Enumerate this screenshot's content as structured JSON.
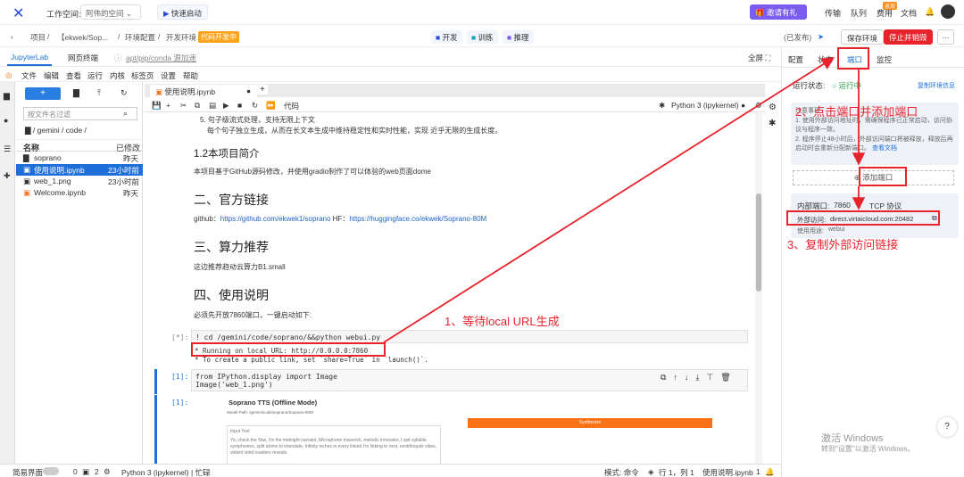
{
  "topbar": {
    "workspace_label": "工作空间:",
    "workspace_value": "阿伟的空间",
    "quick_start": "快速启动",
    "invite": "邀请有礼",
    "links": [
      "传输",
      "队列",
      "费用",
      "文档"
    ],
    "fee_badge": "返现"
  },
  "bar2": {
    "crumbs": [
      "项目",
      "【ekwek/Sop...",
      "环境配置",
      "开发环境"
    ],
    "status_tag": "代码开发中",
    "modes": [
      "开发",
      "训练",
      "推理"
    ],
    "published": "(已发布)",
    "save_env": "保存环境",
    "stop_destroy": "停止并销毁",
    "more": "···"
  },
  "bar3": {
    "tabs": [
      "JupyterLab",
      "网页终端"
    ],
    "path_hint": "apt/pip/conda 源加速",
    "fullscreen": "全屏"
  },
  "menu": [
    "文件",
    "编辑",
    "查看",
    "运行",
    "内核",
    "标签页",
    "设置",
    "帮助"
  ],
  "filebrowser": {
    "new_button": "+",
    "filter_placeholder": "按文件名过滤",
    "path": "/ gemini / code /",
    "col_name": "名称",
    "col_modified": "已修改",
    "files": [
      {
        "name": "soprano",
        "modified": "昨天",
        "selected": false
      },
      {
        "name": "使用说明.ipynb",
        "modified": "23小时前",
        "selected": true
      },
      {
        "name": "web_1.png",
        "modified": "23小时前",
        "selected": false
      },
      {
        "name": "Welcome.ipynb",
        "modified": "昨天",
        "selected": false
      }
    ]
  },
  "notebook": {
    "tab_title": "使用说明.ipynb",
    "cell_type": "代码",
    "kernel": "Python 3 (ipykernel)",
    "lines": {
      "l1": "5. 句子级流式处理，支持无限上下文",
      "l2": "每个句子独立生成，从而在长文本生成中维持稳定性和实时性能，实现 近乎无限的生成长度。",
      "h_intro": "1.2本项目简介",
      "intro": "本项目基于GitHub源码修改，并使用gradio制作了可以体验的web页面dome",
      "h_links": "二、官方链接",
      "github_label": "github：",
      "github_url": "https://github.com/ekwek1/soprano",
      "hf_label": "HF：",
      "hf_url": "https://huggingface.co/ekwek/Soprano-80M",
      "h_compute": "三、算力推荐",
      "compute": "这边推荐趋动云算力B1.small",
      "h_usage": "四、使用说明",
      "usage": "必须先开放7860端口，一键启动如下:",
      "prompt1": "[*]:",
      "code1": "! cd /gemini/code/soprano/&&python webui.py",
      "out1": "* Running on local URL:  http://0.0.0.0:7860",
      "out2": "* To create a public link, set `share=True` in `launch()`.",
      "prompt2": "[1]:",
      "code2a": "from IPython.display import Image",
      "code2b": "Image('web_1.png')",
      "prompt3": "[1]:",
      "gradio_title": "Soprano TTS (Offline Mode)",
      "gradio_model": "Model Path: /gemini/code/soprano/Soprano-80M",
      "gradio_input_label": "Input Text",
      "gradio_input_text": "Yo, check the flow, I'm the midnight narrator, Microphone maverick, melodic innovator, I spit syllable symphonies, split atoms to interstate, Infinity inches in every linked I'm linking to next, ventriloquist vibes, violent wind roasters reveals.",
      "gradio_button": "Synthesize"
    }
  },
  "rpanel": {
    "tabs": [
      "配置",
      "状态",
      "端口",
      "监控"
    ],
    "run_status_label": "运行状态:",
    "run_status": "运行中",
    "copy_env": "复制环境信息",
    "notice_title": "注意事项",
    "notice_1": "1. 使用外部访问地址时，需确保程序已正常启动，访问协议与程序一致。",
    "notice_2": "2. 程序停止48小时后，外部访问端口将被释放，释放后再启动时会重新分配新端口。",
    "notice_link": "查看文档",
    "add_port": "添加端口",
    "inner_port_label": "内部端口:",
    "inner_port": "7860",
    "protocol": "TCP 协议",
    "external_label": "外部访问:",
    "external_url": "direct.virtaicloud.com:20482",
    "usage_label": "使用用途:",
    "usage_value": "webui"
  },
  "annotations": {
    "a1": "1、等待local URL生成",
    "a2": "2、点击端口并添加端口",
    "a3": "3、复制外部访问链接"
  },
  "watermark": {
    "line1": "激活 Windows",
    "line2": "转到\"设置\"以激活 Windows。"
  },
  "statusbar": {
    "simple": "简易界面",
    "count1": "0",
    "count2": "2",
    "kernel": "Python 3 (ipykernel) | 忙碌",
    "mode": "模式: 命令",
    "pos": "行 1，列 1",
    "file": "使用说明.ipynb",
    "num": "1"
  },
  "colors": {
    "accent": "#1e6fd9",
    "annotation": "#e8232c",
    "brand": "#2b4bd8"
  }
}
